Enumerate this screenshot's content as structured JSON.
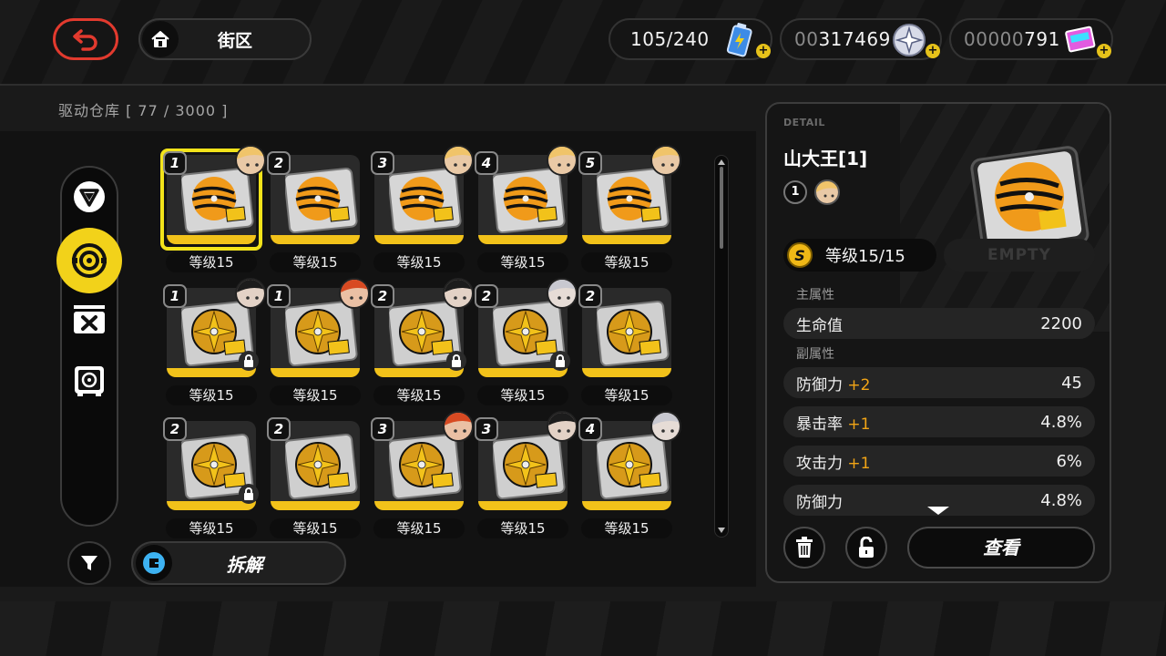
{
  "header": {
    "location": "街区",
    "resources": [
      {
        "name": "battery",
        "value": "105/240",
        "dim_prefix": "",
        "icon": "battery-icon"
      },
      {
        "name": "dennies",
        "value": "317469",
        "dim_prefix": "00",
        "icon": "coin-icon"
      },
      {
        "name": "polychrome",
        "value": "791",
        "dim_prefix": "00000",
        "icon": "film-ticket-icon"
      }
    ]
  },
  "warehouse": {
    "title": "驱动仓库 [ 77 / 3000 ]"
  },
  "actions": {
    "dismantle_label": "拆解"
  },
  "discs": [
    {
      "slot": "1",
      "level": "等级15",
      "type": "tiger",
      "avatar": "blonde",
      "locked": false,
      "selected": true
    },
    {
      "slot": "2",
      "level": "等级15",
      "type": "tiger",
      "avatar": "",
      "locked": false,
      "selected": false
    },
    {
      "slot": "3",
      "level": "等级15",
      "type": "tiger",
      "avatar": "blonde",
      "locked": false,
      "selected": false
    },
    {
      "slot": "4",
      "level": "等级15",
      "type": "tiger",
      "avatar": "blonde",
      "locked": false,
      "selected": false
    },
    {
      "slot": "5",
      "level": "等级15",
      "type": "tiger",
      "avatar": "blonde",
      "locked": false,
      "selected": false
    },
    {
      "slot": "1",
      "level": "等级15",
      "type": "gold",
      "avatar": "dark",
      "locked": true,
      "selected": false
    },
    {
      "slot": "1",
      "level": "等级15",
      "type": "gold",
      "avatar": "red",
      "locked": false,
      "selected": false
    },
    {
      "slot": "2",
      "level": "等级15",
      "type": "gold",
      "avatar": "dark",
      "locked": true,
      "selected": false
    },
    {
      "slot": "2",
      "level": "等级15",
      "type": "gold",
      "avatar": "silver",
      "locked": true,
      "selected": false
    },
    {
      "slot": "2",
      "level": "等级15",
      "type": "gold",
      "avatar": "",
      "locked": false,
      "selected": false
    },
    {
      "slot": "2",
      "level": "等级15",
      "type": "gold",
      "avatar": "",
      "locked": true,
      "selected": false
    },
    {
      "slot": "2",
      "level": "等级15",
      "type": "gold",
      "avatar": "",
      "locked": false,
      "selected": false
    },
    {
      "slot": "3",
      "level": "等级15",
      "type": "gold",
      "avatar": "red",
      "locked": false,
      "selected": false
    },
    {
      "slot": "3",
      "level": "等级15",
      "type": "gold",
      "avatar": "dark",
      "locked": false,
      "selected": false
    },
    {
      "slot": "4",
      "level": "等级15",
      "type": "gold",
      "avatar": "silver",
      "locked": false,
      "selected": false
    }
  ],
  "detail": {
    "header": "DETAIL",
    "name": "山大王[1]",
    "slot": "1",
    "level": "等级15/15",
    "empty": "EMPTY",
    "main_attr_label": "主属性",
    "main_attr": {
      "key": "生命值",
      "value": "2200"
    },
    "sub_attr_label": "副属性",
    "sub_attrs": [
      {
        "key": "防御力",
        "plus": "+2",
        "value": "45"
      },
      {
        "key": "暴击率",
        "plus": "+1",
        "value": "4.8%"
      },
      {
        "key": "攻击力",
        "plus": "+1",
        "value": "6%"
      },
      {
        "key": "防御力",
        "plus": "",
        "value": "4.8%"
      }
    ],
    "view_label": "查看"
  },
  "colors": {
    "accent": "#f2d21a",
    "back": "#e23a2e",
    "plus": "#f2a516"
  }
}
